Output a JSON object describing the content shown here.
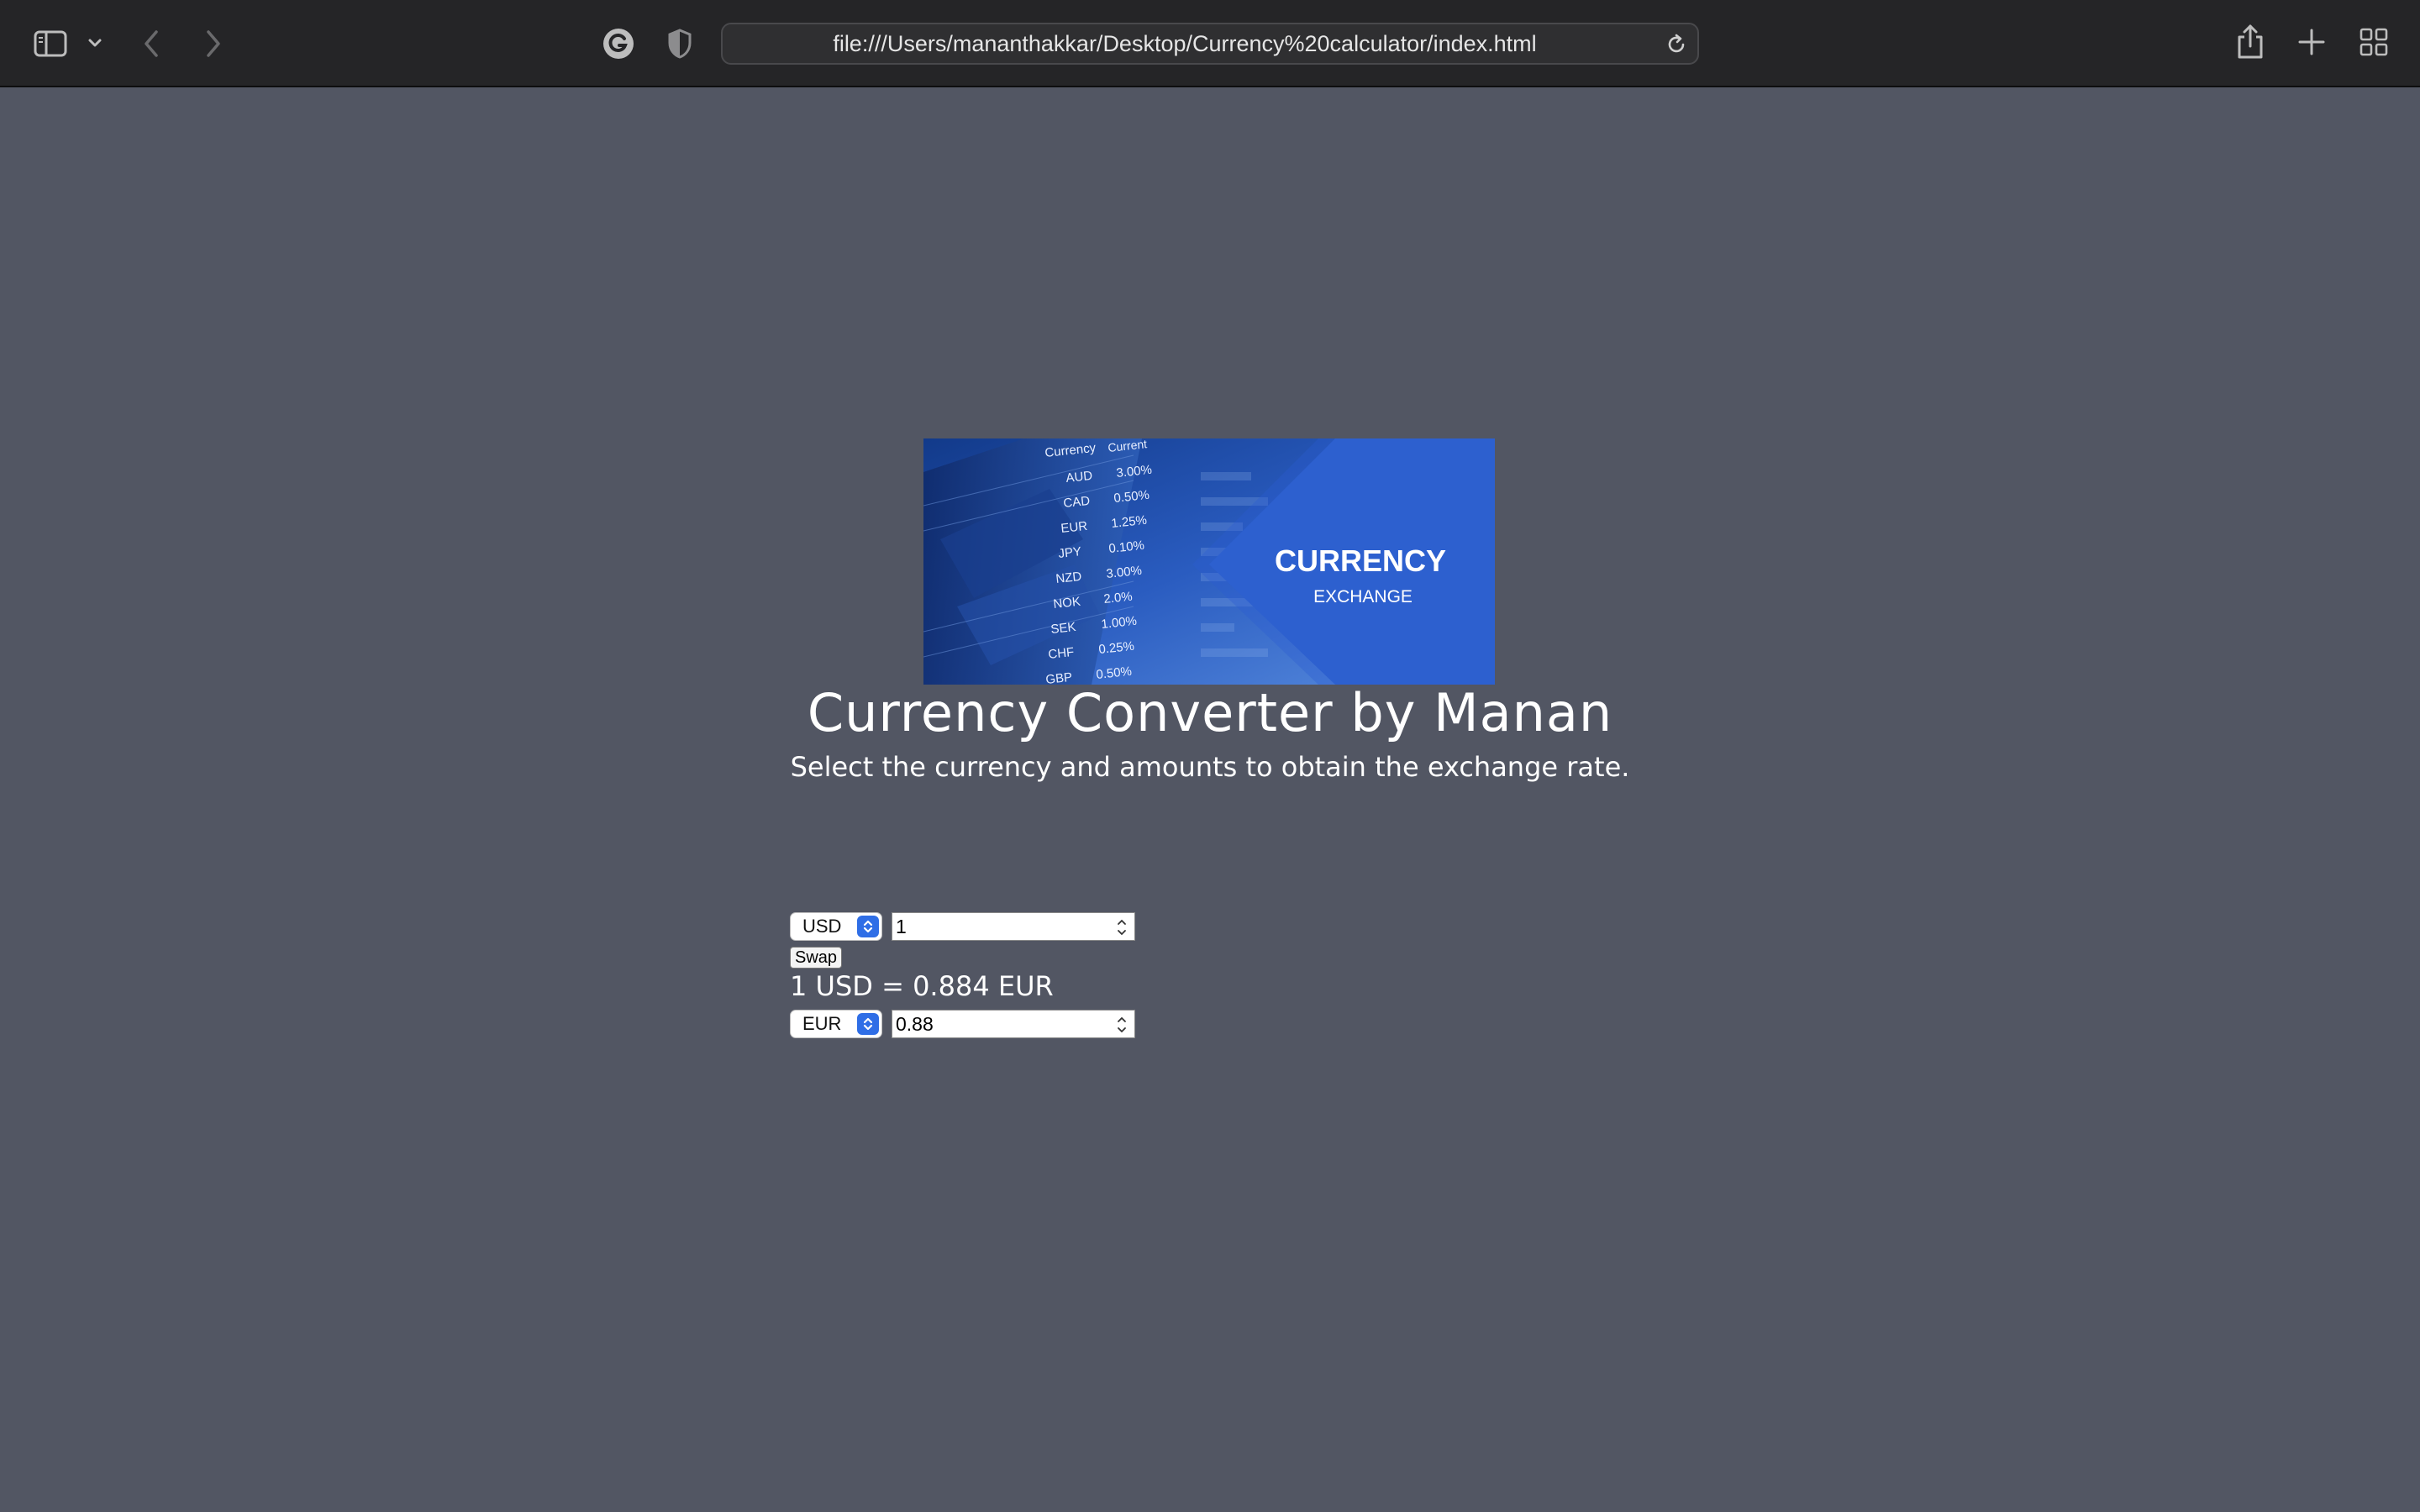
{
  "browser": {
    "url": "file:///Users/mananthakkar/Desktop/Currency%20calculator/index.html",
    "icons": {
      "sidebar": "sidebar-icon",
      "sidebar_menu": "chevron-down-icon",
      "back": "chevron-left-icon",
      "forward": "chevron-right-icon",
      "extension": "grammarly-icon",
      "privacy": "shield-icon",
      "reload": "reload-icon",
      "share": "share-icon",
      "new_tab": "plus-icon",
      "tab_overview": "grid-icon"
    }
  },
  "page": {
    "background": "#525663",
    "banner": {
      "title": "CURRENCY",
      "subtitle": "EXCHANGE",
      "table_header": [
        "Currency",
        "Current"
      ],
      "rows": [
        {
          "code": "AUD",
          "value": "3.00%"
        },
        {
          "code": "CAD",
          "value": "0.50%"
        },
        {
          "code": "EUR",
          "value": "1.25%"
        },
        {
          "code": "JPY",
          "value": "0.10%"
        },
        {
          "code": "NZD",
          "value": "3.00%"
        },
        {
          "code": "NOK",
          "value": "2.0%"
        },
        {
          "code": "SEK",
          "value": "1.00%"
        },
        {
          "code": "CHF",
          "value": "0.25%"
        },
        {
          "code": "GBP",
          "value": "0.50%"
        }
      ]
    },
    "title": "Currency Converter by Manan",
    "subtitle": "Select the currency and amounts to obtain the exchange rate.",
    "converter": {
      "from_currency": "USD",
      "from_amount": "1",
      "swap_label": "Swap",
      "rate_text": "1 USD = 0.884 EUR",
      "to_currency": "EUR",
      "to_amount": "0.88"
    }
  }
}
